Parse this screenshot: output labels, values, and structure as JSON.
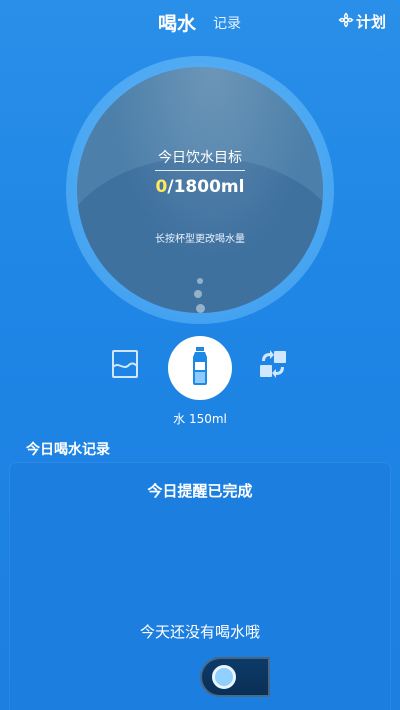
{
  "header": {
    "tab_active": "喝水",
    "tab_inactive": "记录",
    "plan_label": "计划",
    "plan_icon": "flower-icon"
  },
  "goal": {
    "title": "今日饮水目标",
    "current": "0",
    "target": "/1800ml",
    "hint": "长按杯型更改喝水量"
  },
  "cups": {
    "left_icon": "chart-card-icon",
    "center_icon": "water-bottle-icon",
    "right_icon": "switch-arrows-icon",
    "selected_label": "水 150ml"
  },
  "records": {
    "section_title": "今日喝水记录",
    "reminder_status": "今日提醒已完成",
    "empty_text": "今天还没有喝水哦"
  },
  "colors": {
    "background": "#1f86e6",
    "ring": "#5fb2f5",
    "inner_circle": "#4c7fa9",
    "highlight_number": "#ffe85b"
  }
}
